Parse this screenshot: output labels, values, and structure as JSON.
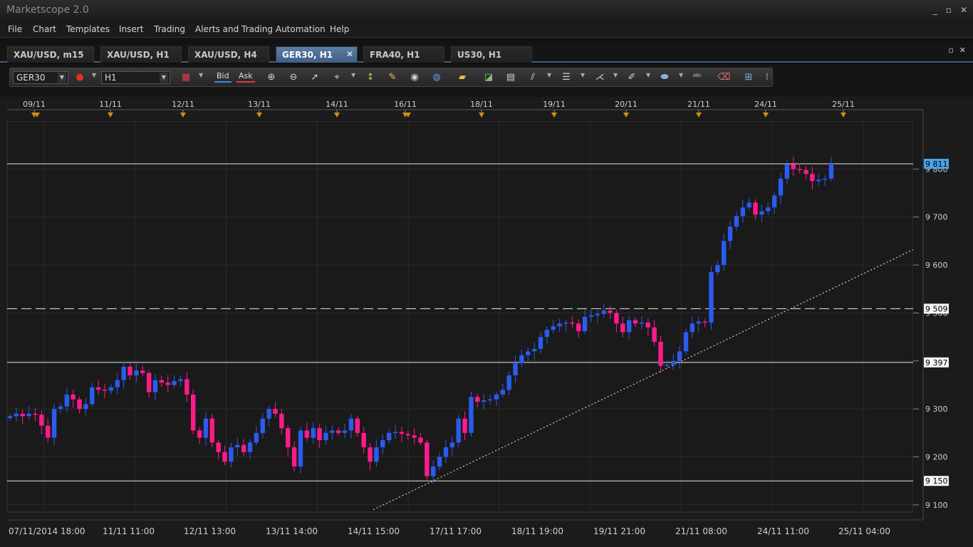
{
  "app": {
    "title": "Marketscope 2.0",
    "window_buttons": [
      "_",
      "▫",
      "✕"
    ]
  },
  "menu": [
    "File",
    "Chart",
    "Templates",
    "Insert",
    "Trading",
    "Alerts and Trading Automation",
    "Help"
  ],
  "tabs": [
    {
      "label": "XAU/USD, m15",
      "active": false
    },
    {
      "label": "XAU/USD, H1",
      "active": false
    },
    {
      "label": "XAU/USD, H4",
      "active": false
    },
    {
      "label": "GER30, H1",
      "active": true
    },
    {
      "label": "FRA40, H1",
      "active": false
    },
    {
      "label": "US30, H1",
      "active": false
    }
  ],
  "toolbar": {
    "instrument": "GER30",
    "timeframe": "H1",
    "bid_label": "Bid",
    "ask_label": "Ask",
    "icons": [
      "candle-type-icon",
      "zoom-in-icon",
      "zoom-out-icon",
      "cursor-icon",
      "crosshair-icon",
      "data-window-icon",
      "chart-properties-icon",
      "eye-icon",
      "globe-icon",
      "ruler-icon",
      "add-indicator-icon",
      "add-study-icon",
      "lines-icon",
      "horizontal-lines-icon",
      "trend-tools-icon",
      "pen-icon",
      "shape-icon",
      "text-icon",
      "eraser-icon",
      "tree-icon",
      "more-icon"
    ]
  },
  "colors": {
    "bull": "#2b5bf0",
    "bear": "#ff1a8c",
    "event_marker": "#c8901c",
    "current_price_bg": "#4aa3e8"
  },
  "chart_data": {
    "type": "candlestick",
    "instrument": "GER30",
    "timeframe": "H1",
    "ylim": [
      9085,
      9900
    ],
    "y_ticks": [
      9100,
      9200,
      9300,
      9400,
      9500,
      9600,
      9700,
      9800
    ],
    "y_tick_labels": [
      "9 100",
      "9 200",
      "9 300",
      "",
      "9 500",
      "9 600",
      "9 700",
      "9 800"
    ],
    "top_date_labels": [
      "09/11",
      "11/11",
      "12/11",
      "13/11",
      "14/11",
      "16/11",
      "18/11",
      "19/11",
      "20/11",
      "21/11",
      "24/11",
      "25/11"
    ],
    "bottom_time_labels": [
      "07/11/2014 18:00",
      "11/11 11:00",
      "12/11 13:00",
      "13/11 14:00",
      "14/11 15:00",
      "17/11 17:00",
      "18/11 19:00",
      "19/11 21:00",
      "21/11 08:00",
      "24/11 11:00",
      "25/11 04:00"
    ],
    "horizontal_lines": [
      {
        "price": 9811,
        "label": "9 811",
        "style": "solid",
        "current": true
      },
      {
        "price": 9509,
        "label": "9 509",
        "style": "dashed"
      },
      {
        "price": 9397,
        "label": "9 397",
        "style": "solid"
      },
      {
        "price": 9150,
        "label": "9 150",
        "style": "solid"
      }
    ],
    "trendline": {
      "from": {
        "index": 0.38,
        "price": 9090
      },
      "to": {
        "index": 1.0,
        "price": 9632
      },
      "style": "dotted"
    },
    "closes": [
      9285,
      9290,
      9285,
      9290,
      9288,
      9265,
      9240,
      9300,
      9305,
      9330,
      9320,
      9300,
      9310,
      9345,
      9340,
      9338,
      9345,
      9360,
      9388,
      9370,
      9380,
      9375,
      9335,
      9360,
      9355,
      9350,
      9358,
      9362,
      9330,
      9255,
      9240,
      9280,
      9230,
      9210,
      9190,
      9220,
      9225,
      9210,
      9230,
      9250,
      9280,
      9300,
      9290,
      9260,
      9220,
      9180,
      9255,
      9240,
      9260,
      9235,
      9250,
      9255,
      9250,
      9255,
      9280,
      9250,
      9220,
      9190,
      9220,
      9235,
      9250,
      9252,
      9248,
      9245,
      9240,
      9230,
      9160,
      9180,
      9200,
      9220,
      9230,
      9280,
      9250,
      9325,
      9315,
      9318,
      9320,
      9330,
      9340,
      9370,
      9395,
      9412,
      9420,
      9425,
      9450,
      9465,
      9472,
      9478,
      9480,
      9478,
      9462,
      9492,
      9495,
      9498,
      9505,
      9500,
      9478,
      9460,
      9485,
      9478,
      9480,
      9470,
      9440,
      9390,
      9392,
      9400,
      9420,
      9460,
      9478,
      9482,
      9480,
      9585,
      9600,
      9650,
      9680,
      9702,
      9720,
      9730,
      9705,
      9712,
      9720,
      9745,
      9780,
      9810,
      9800,
      9798,
      9790,
      9775,
      9778,
      9780,
      9811
    ]
  }
}
